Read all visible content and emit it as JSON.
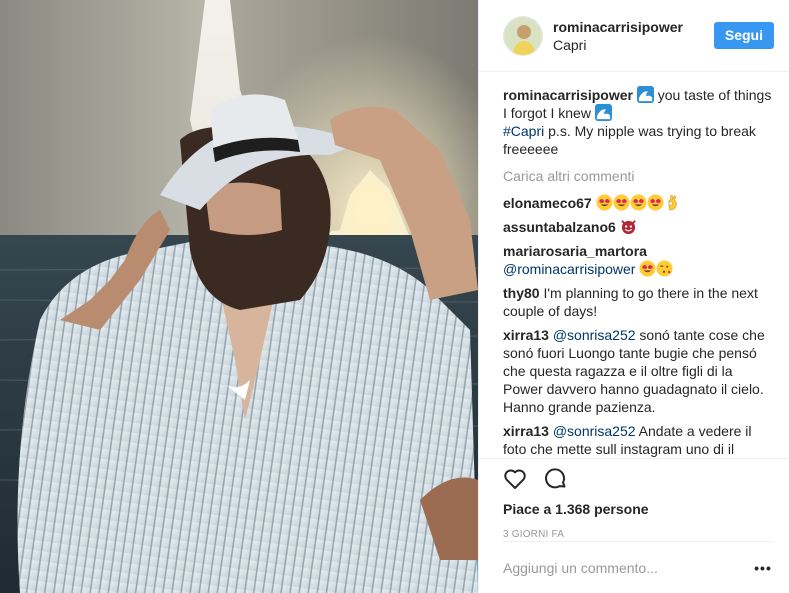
{
  "post": {
    "username": "rominacarrisipower",
    "location": "Capri",
    "follow_label": "Segui",
    "caption_user": "rominacarrisipower",
    "caption_text_1": " you taste of things I forgot I knew ",
    "caption_hashtag": "#Capri",
    "caption_text_2": " p.s. My nipple was trying to break freeeeee"
  },
  "load_more_label": "Carica altri commenti",
  "comments": [
    {
      "user": "elonameco67",
      "mention": "",
      "text": "",
      "emoji": [
        "heart-eyes",
        "heart-eyes",
        "heart-eyes",
        "heart-eyes",
        "ok-hand"
      ]
    },
    {
      "user": "assuntabalzano6",
      "mention": "",
      "text": "",
      "emoji": [
        "devil"
      ]
    },
    {
      "user": "mariarosaria_martora",
      "mention": "@rominacarrisipower",
      "text": "",
      "emoji": [
        "heart-eyes",
        "kiss-wink"
      ]
    },
    {
      "user": "thy80",
      "mention": "",
      "text": "I'm planning to go there in the next couple of days!",
      "emoji": []
    },
    {
      "user": "xirra13",
      "mention": "@sonrisa252",
      "text": "sonó tante cose che sonó fuori Luongo tante bugie che pensó che questa ragazza e il oltre figli di la Power davvero hanno guadagnato il cielo. Hanno grande pazienza.",
      "emoji": []
    },
    {
      "user": "xirra13",
      "mention": "@sonrisa252",
      "text": "Andate a vedere il foto che mette sull instagram uno di il",
      "emoji": []
    }
  ],
  "likes_label": "Piace a 1.368 persone",
  "timestamp": "3 giorni fa",
  "add_comment_placeholder": "Aggiungi un commento...",
  "icons": {
    "like": "heart-outline-icon",
    "comment": "comment-bubble-icon",
    "more": "more-options-icon",
    "wave": "wave-emoji"
  },
  "colors": {
    "follow": "#3897f0",
    "hashtag": "#003569",
    "muted": "#999999",
    "text": "#262626"
  }
}
